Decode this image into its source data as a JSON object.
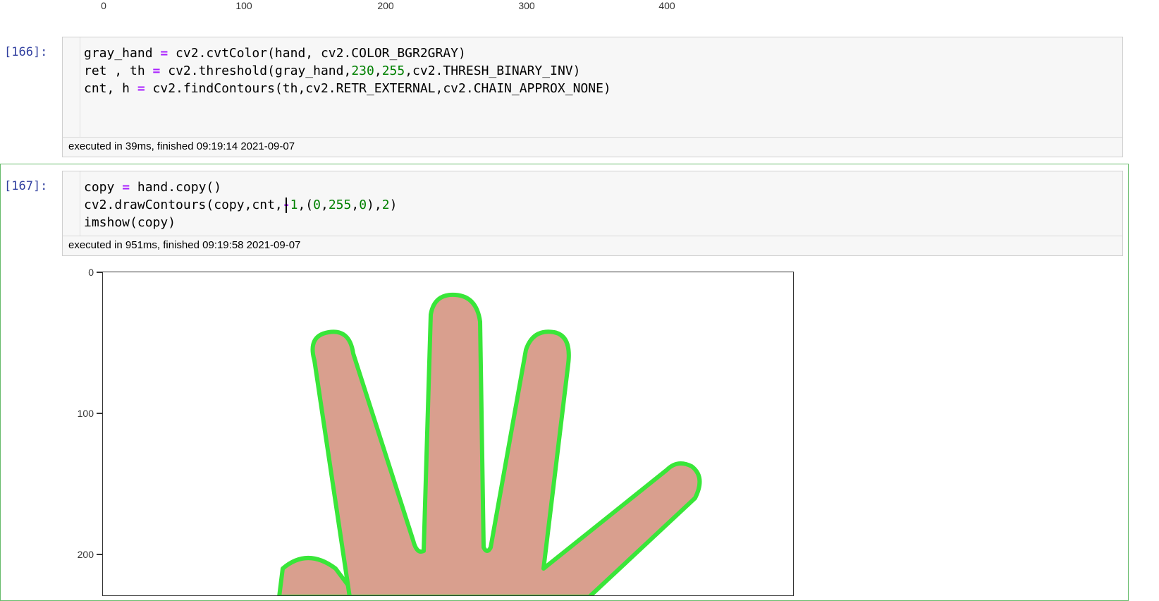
{
  "previous_output": {
    "x_ticks": [
      "0",
      "100",
      "200",
      "300",
      "400"
    ]
  },
  "cells": [
    {
      "prompt": "[166]:",
      "code": [
        [
          {
            "t": "gray_hand "
          },
          {
            "t": "=",
            "c": "op"
          },
          {
            "t": " cv2.cvtColor(hand, cv2.COLOR_BGR2GRAY)"
          }
        ],
        [
          {
            "t": "ret , th "
          },
          {
            "t": "=",
            "c": "op"
          },
          {
            "t": " cv2.threshold(gray_hand,"
          },
          {
            "t": "230",
            "c": "num"
          },
          {
            "t": ","
          },
          {
            "t": "255",
            "c": "num"
          },
          {
            "t": ",cv2.THRESH_BINARY_INV)"
          }
        ],
        [
          {
            "t": "cnt, h "
          },
          {
            "t": "=",
            "c": "op"
          },
          {
            "t": " cv2.findContours(th,cv2.RETR_EXTERNAL,cv2.CHAIN_APPROX_NONE)"
          }
        ]
      ],
      "execution": "executed in 39ms, finished 09:19:14 2021-09-07"
    },
    {
      "prompt": "[167]:",
      "code": [
        [
          {
            "t": "copy "
          },
          {
            "t": "=",
            "c": "op"
          },
          {
            "t": " hand.copy()"
          }
        ],
        [
          {
            "t": "cv2.drawContours(copy,cnt,"
          },
          {
            "t": "-",
            "c": "op"
          },
          {
            "t": "1",
            "c": "num"
          },
          {
            "t": ",("
          },
          {
            "t": "0",
            "c": "num"
          },
          {
            "t": ","
          },
          {
            "t": "255",
            "c": "num"
          },
          {
            "t": ","
          },
          {
            "t": "0",
            "c": "num"
          },
          {
            "t": "),"
          },
          {
            "t": "2",
            "c": "num"
          },
          {
            "t": ")"
          }
        ],
        [
          {
            "t": "imshow(copy)"
          }
        ]
      ],
      "execution": "executed in 951ms, finished 09:19:58 2021-09-07"
    }
  ],
  "output_plot": {
    "y_ticks": [
      "0",
      "100",
      "200"
    ],
    "contour_color": "#39e639",
    "skin_color": "#d99f8e"
  }
}
